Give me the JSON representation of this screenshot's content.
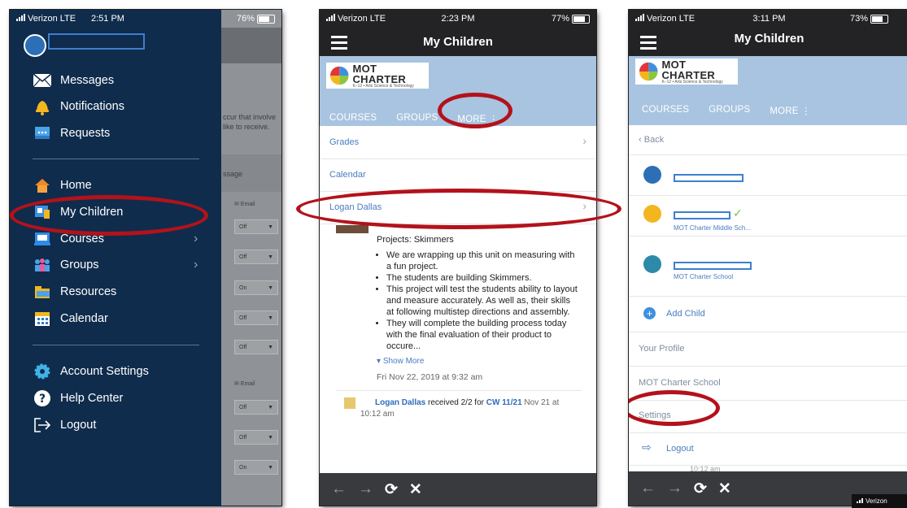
{
  "phone1": {
    "status": {
      "carrier": "Verizon LTE",
      "time": "2:51 PM",
      "battery": "76%"
    },
    "menu": [
      {
        "label": "Messages",
        "icon": "envelope-icon"
      },
      {
        "label": "Notifications",
        "icon": "bell-icon"
      },
      {
        "label": "Requests",
        "icon": "requests-icon"
      },
      {
        "label": "Home",
        "icon": "home-icon"
      },
      {
        "label": "My Children",
        "icon": "children-icon"
      },
      {
        "label": "Courses",
        "icon": "courses-icon"
      },
      {
        "label": "Groups",
        "icon": "groups-icon"
      },
      {
        "label": "Resources",
        "icon": "folder-icon"
      },
      {
        "label": "Calendar",
        "icon": "calendar-icon"
      },
      {
        "label": "Account Settings",
        "icon": "gear-icon"
      },
      {
        "label": "Help Center",
        "icon": "help-icon"
      },
      {
        "label": "Logout",
        "icon": "logout-icon"
      }
    ],
    "background": {
      "text1": "ccur that involve",
      "text2": "like to receive.",
      "text3": "ssage",
      "email1": "Email",
      "email2": "Email",
      "selects": [
        "Off",
        "Off",
        "On",
        "Off",
        "Off",
        "Off",
        "Off",
        "On"
      ]
    }
  },
  "phone2": {
    "status": {
      "carrier": "Verizon LTE",
      "time": "2:23 PM",
      "battery": "77%"
    },
    "title": "My Children",
    "logo": {
      "name": "MOT CHARTER",
      "tagline": "K–12 • Arts Science & Technology"
    },
    "tabs": [
      "COURSES",
      "GROUPS",
      "MORE ⋮"
    ],
    "dropdown": [
      "Grades",
      "Calendar",
      "Logan Dallas"
    ],
    "post": {
      "heading": "Projects: Skimmers",
      "bullets": [
        "We are wrapping up this unit on measuring with a fun project.",
        "The students are building Skimmers.",
        "This project will test the students ability to layout and measure accurately. As well as, their skills at following multistep directions and assembly.",
        "They will complete the building process today with the final evaluation of their product to occure..."
      ],
      "show_more": "Show More",
      "date": "Fri Nov 22, 2019 at 9:32 am",
      "grade_name": "Logan Dallas",
      "grade_text": " received 2/2 for ",
      "grade_item": "CW 11/21",
      "grade_date": " Nov 21 at",
      "grade_time": "10:12 am"
    }
  },
  "phone3": {
    "status": {
      "carrier": "Verizon LTE",
      "time": "3:11 PM",
      "battery": "73%"
    },
    "title": "My Children",
    "logo": {
      "name": "MOT CHARTER",
      "tagline": "K–12 • Arts Science & Technology"
    },
    "tabs": [
      "COURSES",
      "GROUPS",
      "MORE ⋮"
    ],
    "back": "Back",
    "kids": [
      {
        "school": ""
      },
      {
        "school": "MOT Charter Middle Sch..."
      },
      {
        "school": "MOT Charter School"
      }
    ],
    "add_child": "Add Child",
    "your_profile": "Your Profile",
    "school": "MOT Charter School",
    "settings": "Settings",
    "logout": "Logout",
    "under_time": "10:12 am",
    "corner": "Verizon"
  },
  "colors": {
    "drawer": "#0f2c4c",
    "accent": "#b3121b",
    "band": "#a8c4e0",
    "link": "#4a7cc0"
  }
}
